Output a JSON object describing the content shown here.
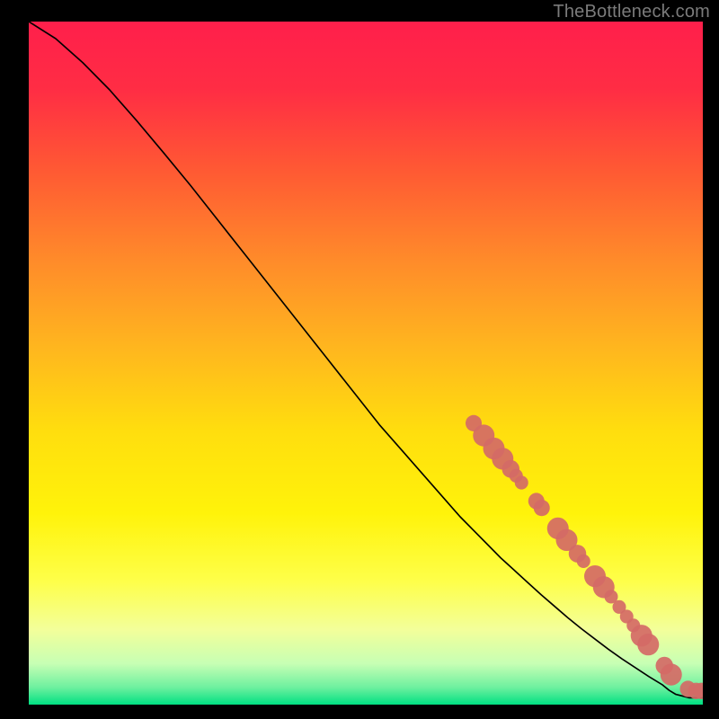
{
  "watermark": "TheBottleneck.com",
  "chart_data": {
    "type": "line",
    "title": "",
    "xlabel": "",
    "ylabel": "",
    "xlim": [
      0,
      100
    ],
    "ylim": [
      0,
      100
    ],
    "grid": false,
    "background_gradient": {
      "top": "#ff1f4b",
      "upper_mid": "#ff8b2a",
      "mid": "#ffe100",
      "lower_mid": "#f8ff66",
      "lower": "#d8ffb0",
      "bottom": "#00e082"
    },
    "series": [
      {
        "name": "bottleneck-curve",
        "color": "#000000",
        "x": [
          0,
          4,
          8,
          12,
          16,
          20,
          24,
          28,
          32,
          36,
          40,
          44,
          48,
          52,
          56,
          60,
          64,
          66,
          68,
          70,
          72,
          74,
          76,
          78,
          80,
          82,
          84,
          86,
          88,
          90,
          92,
          94,
          95,
          96,
          98,
          100
        ],
        "y": [
          100,
          97.5,
          94,
          90,
          85.5,
          80.8,
          76,
          71,
          66,
          61,
          56,
          51,
          46,
          41,
          36.5,
          32,
          27.5,
          25.5,
          23.5,
          21.5,
          19.7,
          17.9,
          16.1,
          14.4,
          12.7,
          11.1,
          9.6,
          8.1,
          6.7,
          5.4,
          4.1,
          2.9,
          2.1,
          1.5,
          1.0,
          1.0
        ]
      }
    ],
    "scatter": [
      {
        "name": "bottleneck-points",
        "color": "#d46a66",
        "points": [
          {
            "x": 66,
            "y": 41.2,
            "r": 1.2
          },
          {
            "x": 67.5,
            "y": 39.4,
            "r": 1.6
          },
          {
            "x": 69,
            "y": 37.5,
            "r": 1.6
          },
          {
            "x": 70.3,
            "y": 36.0,
            "r": 1.6
          },
          {
            "x": 71.5,
            "y": 34.5,
            "r": 1.3
          },
          {
            "x": 72.3,
            "y": 33.5,
            "r": 1.0
          },
          {
            "x": 73.1,
            "y": 32.5,
            "r": 1.0
          },
          {
            "x": 75.3,
            "y": 29.8,
            "r": 1.2
          },
          {
            "x": 76.1,
            "y": 28.8,
            "r": 1.2
          },
          {
            "x": 78.5,
            "y": 25.8,
            "r": 1.6
          },
          {
            "x": 79.8,
            "y": 24.1,
            "r": 1.6
          },
          {
            "x": 81.4,
            "y": 22.1,
            "r": 1.3
          },
          {
            "x": 82.3,
            "y": 21.0,
            "r": 1.0
          },
          {
            "x": 84.0,
            "y": 18.8,
            "r": 1.6
          },
          {
            "x": 85.3,
            "y": 17.2,
            "r": 1.6
          },
          {
            "x": 86.4,
            "y": 15.8,
            "r": 1.0
          },
          {
            "x": 87.6,
            "y": 14.3,
            "r": 1.0
          },
          {
            "x": 88.7,
            "y": 12.9,
            "r": 1.0
          },
          {
            "x": 89.7,
            "y": 11.6,
            "r": 1.0
          },
          {
            "x": 90.9,
            "y": 10.1,
            "r": 1.6
          },
          {
            "x": 91.9,
            "y": 8.8,
            "r": 1.6
          },
          {
            "x": 94.3,
            "y": 5.7,
            "r": 1.3
          },
          {
            "x": 95.3,
            "y": 4.4,
            "r": 1.6
          },
          {
            "x": 97.8,
            "y": 2.3,
            "r": 1.2
          },
          {
            "x": 99.0,
            "y": 2.0,
            "r": 1.2
          },
          {
            "x": 99.8,
            "y": 2.0,
            "r": 1.2
          }
        ]
      }
    ]
  }
}
